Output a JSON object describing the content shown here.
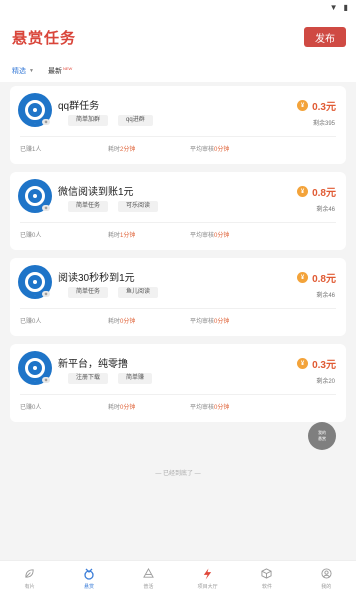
{
  "header": {
    "title": "悬赏任务",
    "publish_label": "发布"
  },
  "filter": {
    "select_label": "精选",
    "latest_label": "最新",
    "new_badge": "NEW"
  },
  "tasks": [
    {
      "name": "qq群任务",
      "tags": [
        "简单加群",
        "qq进群"
      ],
      "reward": "0.3元",
      "remaining": "剩余395",
      "done_prefix": "已赚1人",
      "time_prefix": "耗时",
      "time_value": "2分钟",
      "review_prefix": "平均审核",
      "review_value": "0分钟"
    },
    {
      "name": "微信阅读到账1元",
      "tags": [
        "简单任务",
        "可乐阅读"
      ],
      "reward": "0.8元",
      "remaining": "剩余46",
      "done_prefix": "已赚0人",
      "time_prefix": "耗时",
      "time_value": "1分钟",
      "review_prefix": "平均审核",
      "review_value": "0分钟"
    },
    {
      "name": "阅读30秒秒到1元",
      "tags": [
        "简单任务",
        "鱼儿阅读"
      ],
      "reward": "0.8元",
      "remaining": "剩余46",
      "done_prefix": "已赚0人",
      "time_prefix": "耗时",
      "time_value": "0分钟",
      "review_prefix": "平均审核",
      "review_value": "0分钟"
    },
    {
      "name": "新平台，纯零撸",
      "tags": [
        "注册下载",
        "简单赚"
      ],
      "reward": "0.3元",
      "remaining": "剩余20",
      "done_prefix": "已赚0人",
      "time_prefix": "耗时",
      "time_value": "0分钟",
      "review_prefix": "平均审核",
      "review_value": "0分钟"
    }
  ],
  "float_button": {
    "line1": "我的",
    "line2": "悬赏"
  },
  "end_text": "— 已经到底了 —",
  "bottom_nav": [
    {
      "label": "有片",
      "icon": "leaf-icon"
    },
    {
      "label": "悬赏",
      "icon": "reward-icon"
    },
    {
      "label": "普活",
      "icon": "activity-icon"
    },
    {
      "label": "项目大厅",
      "icon": "lightning-icon"
    },
    {
      "label": "软件",
      "icon": "box-icon"
    },
    {
      "label": "我的",
      "icon": "user-icon"
    }
  ],
  "colors": {
    "brand_red": "#cf4a43",
    "accent_blue": "#3b7dd8",
    "coin": "#f3a33a"
  }
}
